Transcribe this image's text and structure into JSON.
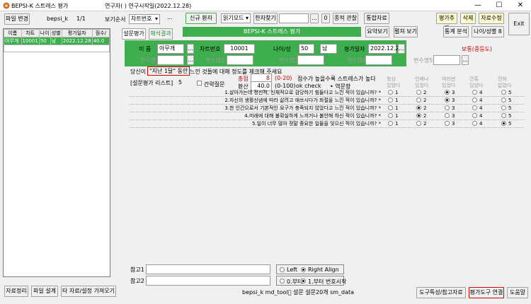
{
  "window": {
    "title": "BEPSI-K 스트레스 평가",
    "subtitle": "연구자(         ) 연구시작일(2022.12.28)",
    "min": "—",
    "max": "☐",
    "close": "✕"
  },
  "toolbar": {
    "file_change": "파일 변경",
    "file_name": "bepsi_k",
    "page": "1/1",
    "view_order_label": "보기순서",
    "view_order_value": "차트번호",
    "more": "...",
    "new_patient": "신규 환자",
    "mode_value": "읽기모드",
    "kanji_find": "한자찾기",
    "kanji_value": "",
    "ellipsis": "...",
    "zero": "0",
    "view_chart": "종적 관찰",
    "stats_data": "통합자료",
    "eval_add": "평가추가",
    "delete": "삭제",
    "data_edit": "자료수정",
    "summary_view": "요약보기",
    "open_view": "펼쳐 보기",
    "stats_analysis": "통계 분석",
    "age_gender": "나이/성별 8",
    "exit": "Exit"
  },
  "tabs": {
    "survey": "설문평가",
    "result": "해석결과"
  },
  "banner": "BEPSI-K 스트레스 평가",
  "grid": {
    "headers": [
      "이름",
      "차트",
      "나이",
      "성별",
      "평가일자",
      "점수/"
    ],
    "rows": [
      [
        "아무개",
        "10001",
        "50",
        "남",
        "2022.12.28",
        "40.0"
      ]
    ]
  },
  "patient": {
    "name_label": "이 름",
    "name": "아무개",
    "chart_label": "차트번호",
    "chart": "10001",
    "age_label": "나이/성",
    "age": "50",
    "gender": "남",
    "date_label": "평가일자",
    "date": "2022.12.28",
    "level": "보통(중등도)",
    "vars": [
      "변수명1",
      "변수명2",
      "변수명3",
      "변수명4",
      "변수명5"
    ]
  },
  "instructions": {
    "prefix": "당신이",
    "highlight": "\"지난 1달\" 동안",
    "suffix": "느낀 것들에 대해 정도를 체크해 주세요",
    "list_label": "[설문평가 리스트]",
    "list_count": "5",
    "simple_q": "간략질문",
    "total_label": "총점",
    "total": "8",
    "total_range": "(0-20)",
    "note": "점수가 높을수록 스트레스가 높다",
    "convert_label": "환산",
    "convert": "40.0",
    "convert_range": "(0-100)",
    "ok_check": "ok check",
    "reverse": "• 역문항"
  },
  "columns": [
    [
      "항상",
      "있었다"
    ],
    [
      "언제나",
      "있었다"
    ],
    [
      "여러번",
      "있었다"
    ],
    [
      "간혹",
      "있었다"
    ],
    [
      "전혀",
      "없었다"
    ]
  ],
  "questions": [
    {
      "text": "1.살아가는데 정신적, 신체적으로 감당하기 힘들다고 느낀 적이 있습니까? *",
      "selected": 2
    },
    {
      "text": "2.자신의 생활신념에 따라 삶려고 애쓰시다가 좌절을 느낀 적이 있습니까? *",
      "selected": 2
    },
    {
      "text": "3.한 인간으로서 기본적인 요구가 충족되지 않았다고 느낀 적이 있습니까? *",
      "selected": 1
    },
    {
      "text": "4.미래에 대해 불확실하게 느끼거나 불안해 하신 적이 있습니까? *",
      "selected": 1
    },
    {
      "text": "5.일이 너무 많아 정말 중요한 일들을 잊으신 적이 있습니까? *",
      "selected": 4
    }
  ],
  "radio_nums": [
    "1",
    "2",
    "3",
    "4",
    "5"
  ],
  "footer": {
    "ref1": "참고1",
    "ref2": "참고2",
    "left": "Left",
    "right": "Right Align",
    "start0": "0.부터",
    "start1": "1.부터 번호시작"
  },
  "bottom": {
    "data_clean": "자료정리",
    "file_design": "파일 설계",
    "other_import": "타 자료/설정 가져오기",
    "status": "bepsi_k   md_tool\u0000 설문 설문20개   sm_data",
    "tool_ref": "도구특성/참고자료",
    "tool_link": "평가도구 연결",
    "help": "도움말"
  }
}
